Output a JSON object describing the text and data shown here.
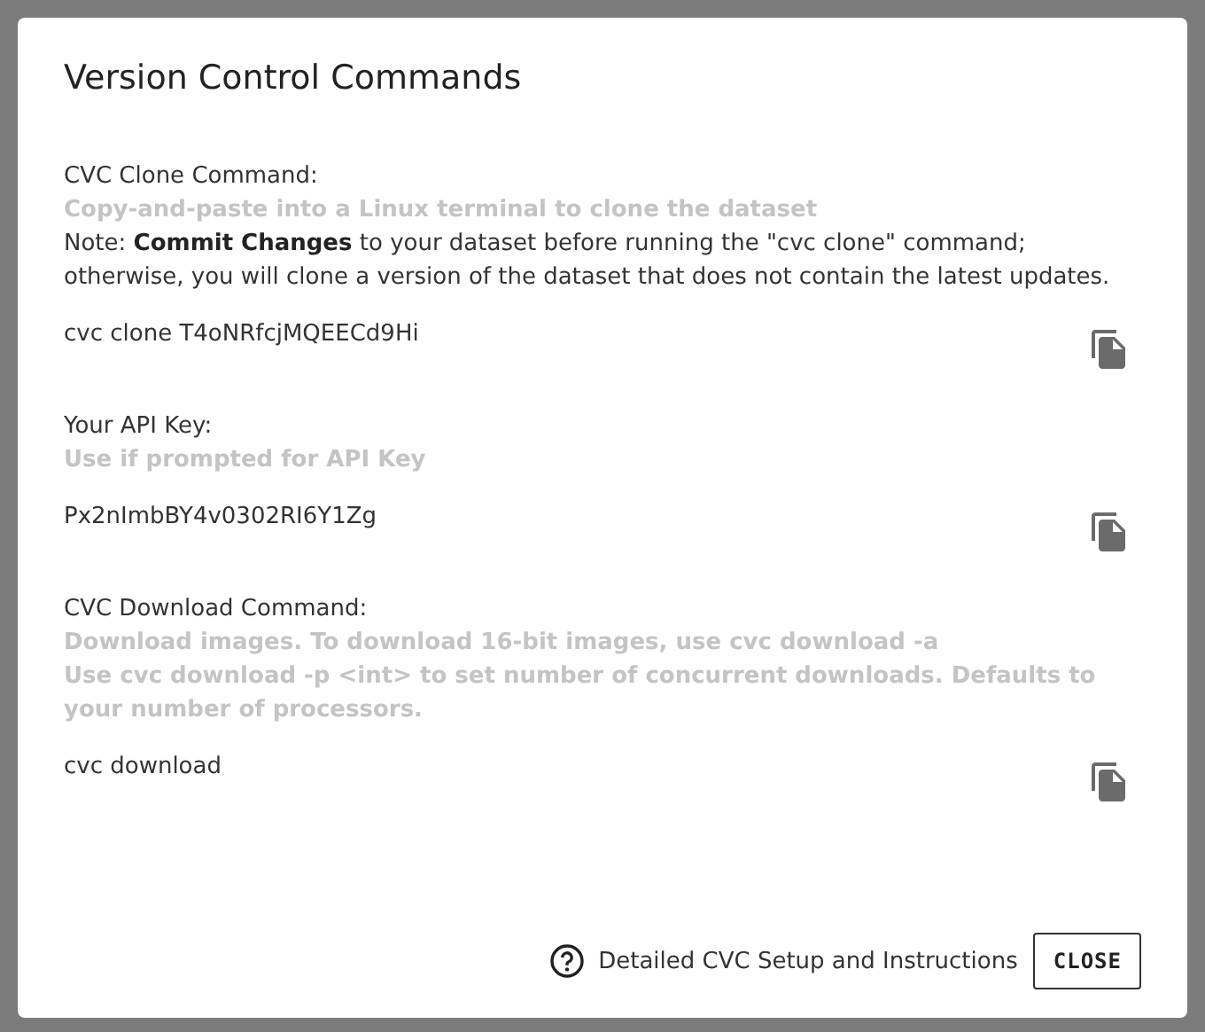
{
  "dialog": {
    "title": "Version Control Commands"
  },
  "sections": [
    {
      "label": "CVC Clone Command:",
      "hints": [
        "Copy-and-paste into a Linux terminal to clone the dataset"
      ],
      "note": "Note: **Commit Changes** to your dataset before running the \"cvc clone\" command; otherwise, you will clone a version of the dataset that does not contain the latest updates.",
      "value": "cvc clone T4oNRfcjMQEECd9Hi"
    },
    {
      "label": "Your API Key:",
      "hints": [
        "Use if prompted for API Key"
      ],
      "value": "Px2nImbBY4v0302RI6Y1Zg"
    },
    {
      "label": "CVC Download Command:",
      "hints": [
        "Download images. To download 16-bit images, use cvc download -a",
        "Use cvc download -p <int> to set number of concurrent downloads. Defaults to your number of processors."
      ],
      "value": "cvc download"
    }
  ],
  "footer": {
    "help_link": "Detailed CVC Setup and Instructions",
    "close_button": "CLOSE"
  }
}
